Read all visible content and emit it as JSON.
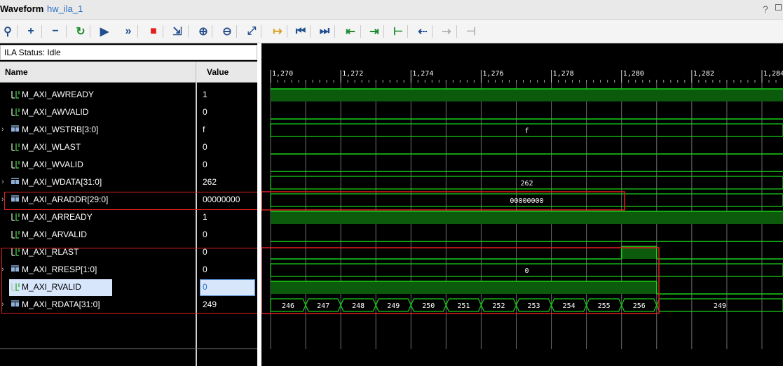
{
  "window": {
    "title": "Waveform",
    "subtitle": "hw_ila_1",
    "help": "?"
  },
  "toolbar": {
    "buttons": [
      {
        "name": "search",
        "glyph": "⚲",
        "color": "#2a4e8c"
      },
      {
        "name": "add",
        "glyph": "+",
        "color": "#1f4f8f"
      },
      {
        "name": "remove",
        "glyph": "−",
        "color": "#1f4f8f"
      },
      {
        "name": "run-trigger",
        "glyph": "↻",
        "color": "#1e8a2e"
      },
      {
        "name": "run",
        "glyph": "▶",
        "color": "#1f4f8f"
      },
      {
        "name": "run-immediate",
        "glyph": "»",
        "color": "#1f4f8f"
      },
      {
        "name": "stop",
        "glyph": "■",
        "color": "#e02020"
      },
      {
        "name": "export",
        "glyph": "⇲",
        "color": "#2a4e8c"
      },
      {
        "name": "zoom-in",
        "glyph": "⊕",
        "color": "#2a4e8c"
      },
      {
        "name": "zoom-out",
        "glyph": "⊖",
        "color": "#2a4e8c"
      },
      {
        "name": "zoom-fit",
        "glyph": "⤢",
        "color": "#2a4e8c"
      },
      {
        "name": "goto-cursor",
        "glyph": "↦",
        "color": "#d8a020"
      },
      {
        "name": "goto-start",
        "glyph": "⏮",
        "color": "#1f4f8f"
      },
      {
        "name": "goto-end",
        "glyph": "⏭",
        "color": "#1f4f8f"
      },
      {
        "name": "prev-transition",
        "glyph": "⇤",
        "color": "#1e8a2e"
      },
      {
        "name": "next-transition",
        "glyph": "⇥",
        "color": "#1e8a2e"
      },
      {
        "name": "add-marker",
        "glyph": "⊢",
        "color": "#1e8a2e"
      },
      {
        "name": "prev-marker",
        "glyph": "⇠",
        "color": "#1f4f8f"
      },
      {
        "name": "next-marker",
        "glyph": "⇢",
        "color": "#b0b0b0"
      },
      {
        "name": "swap-cursors",
        "glyph": "⊣",
        "color": "#b0b0b0"
      }
    ]
  },
  "status": "ILA Status:  Idle",
  "columns": {
    "name": "Name",
    "value": "Value"
  },
  "signals": [
    {
      "name": "M_AXI_AWREADY",
      "value": "1",
      "bus": false
    },
    {
      "name": "M_AXI_AWVALID",
      "value": "0",
      "bus": false
    },
    {
      "name": "M_AXI_WSTRB[3:0]",
      "value": "f",
      "bus": true
    },
    {
      "name": "M_AXI_WLAST",
      "value": "0",
      "bus": false
    },
    {
      "name": "M_AXI_WVALID",
      "value": "0",
      "bus": false
    },
    {
      "name": "M_AXI_WDATA[31:0]",
      "value": "262",
      "bus": true
    },
    {
      "name": "M_AXI_ARADDR[29:0]",
      "value": "00000000",
      "bus": true
    },
    {
      "name": "M_AXI_ARREADY",
      "value": "1",
      "bus": false
    },
    {
      "name": "M_AXI_ARVALID",
      "value": "0",
      "bus": false
    },
    {
      "name": "M_AXI_RLAST",
      "value": "0",
      "bus": false
    },
    {
      "name": "M_AXI_RRESP[1:0]",
      "value": "0",
      "bus": true
    },
    {
      "name": "M_AXI_RVALID",
      "value": "0",
      "bus": false,
      "selected": true
    },
    {
      "name": "M_AXI_RDATA[31:0]",
      "value": "249",
      "bus": true
    }
  ],
  "timeline": {
    "ticks": [
      "1,270",
      "1,272",
      "1,274",
      "1,276",
      "1,278",
      "1,280",
      "1,282",
      "1,284"
    ],
    "start": 1270,
    "end": 1284.6
  },
  "waves": {
    "M_AXI_AWREADY": {
      "kind": "bit",
      "segments": [
        {
          "from": 1270,
          "to": 1284.6,
          "level": 1
        }
      ]
    },
    "M_AXI_AWVALID": {
      "kind": "bit",
      "segments": [
        {
          "from": 1270,
          "to": 1284.6,
          "level": 0
        }
      ]
    },
    "M_AXI_WSTRB[3:0]": {
      "kind": "bus",
      "segments": [
        {
          "from": 1270,
          "to": 1284.6,
          "label": "f"
        }
      ]
    },
    "M_AXI_WLAST": {
      "kind": "bit",
      "segments": [
        {
          "from": 1270,
          "to": 1284.6,
          "level": 0
        }
      ]
    },
    "M_AXI_WVALID": {
      "kind": "bit",
      "segments": [
        {
          "from": 1270,
          "to": 1284.6,
          "level": 0
        }
      ]
    },
    "M_AXI_WDATA[31:0]": {
      "kind": "bus",
      "segments": [
        {
          "from": 1270,
          "to": 1284.6,
          "label": "262"
        }
      ]
    },
    "M_AXI_ARADDR[29:0]": {
      "kind": "bus",
      "segments": [
        {
          "from": 1270,
          "to": 1284.6,
          "label": "00000000"
        }
      ]
    },
    "M_AXI_ARREADY": {
      "kind": "bit",
      "segments": [
        {
          "from": 1270,
          "to": 1284.6,
          "level": 1
        }
      ]
    },
    "M_AXI_ARVALID": {
      "kind": "bit",
      "segments": [
        {
          "from": 1270,
          "to": 1284.6,
          "level": 0
        }
      ]
    },
    "M_AXI_RLAST": {
      "kind": "bit",
      "segments": [
        {
          "from": 1270,
          "to": 1280,
          "level": 0
        },
        {
          "from": 1280,
          "to": 1281,
          "level": 1
        },
        {
          "from": 1281,
          "to": 1284.6,
          "level": 0
        }
      ]
    },
    "M_AXI_RRESP[1:0]": {
      "kind": "bus",
      "segments": [
        {
          "from": 1270,
          "to": 1284.6,
          "label": "0"
        }
      ]
    },
    "M_AXI_RVALID": {
      "kind": "bit",
      "segments": [
        {
          "from": 1270,
          "to": 1281,
          "level": 1
        },
        {
          "from": 1281,
          "to": 1284.6,
          "level": 0
        }
      ]
    },
    "M_AXI_RDATA[31:0]": {
      "kind": "bus",
      "segments": [
        {
          "from": 1270,
          "to": 1271,
          "label": "246"
        },
        {
          "from": 1271,
          "to": 1272,
          "label": "247"
        },
        {
          "from": 1272,
          "to": 1273,
          "label": "248"
        },
        {
          "from": 1273,
          "to": 1274,
          "label": "249"
        },
        {
          "from": 1274,
          "to": 1275,
          "label": "250"
        },
        {
          "from": 1275,
          "to": 1276,
          "label": "251"
        },
        {
          "from": 1276,
          "to": 1277,
          "label": "252"
        },
        {
          "from": 1277,
          "to": 1278,
          "label": "253"
        },
        {
          "from": 1278,
          "to": 1279,
          "label": "254"
        },
        {
          "from": 1279,
          "to": 1280,
          "label": "255"
        },
        {
          "from": 1280,
          "to": 1281,
          "label": "256"
        },
        {
          "from": 1281,
          "to": 1284.6,
          "label": "249"
        }
      ]
    }
  },
  "colors": {
    "wave": "#19d019",
    "wave_fill": "#0c5a0c",
    "grid": "#6a6a6a",
    "highlight": "#e02020",
    "text": "#ffffff"
  }
}
